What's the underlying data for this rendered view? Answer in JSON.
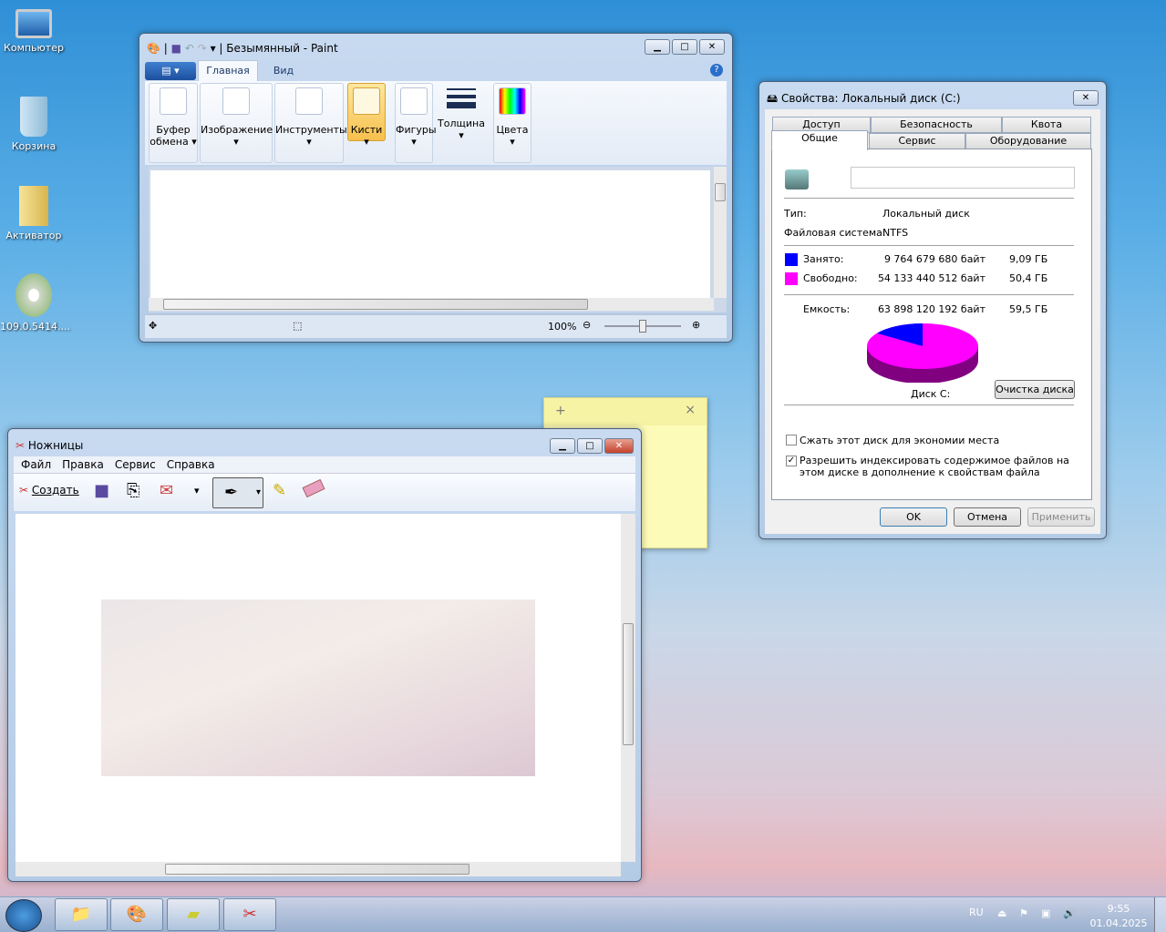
{
  "desktop": {
    "icons": [
      {
        "label": "Компьютер"
      },
      {
        "label": "Корзина"
      },
      {
        "label": "Активатор"
      },
      {
        "label": "109.0.5414...."
      }
    ]
  },
  "paint": {
    "title": "Безымянный - Paint",
    "tabs": [
      {
        "label": "Главная"
      },
      {
        "label": "Вид"
      }
    ],
    "groups": [
      {
        "label": "Буфер обмена"
      },
      {
        "label": "Изображение"
      },
      {
        "label": "Инструменты"
      },
      {
        "label": "Кисти"
      },
      {
        "label": "Фигуры"
      },
      {
        "label": "Толщина"
      },
      {
        "label": "Цвета"
      }
    ],
    "zoom": "100%"
  },
  "props": {
    "title": "Свойства: Локальный диск (C:)",
    "tabs_back": [
      {
        "label": "Доступ"
      },
      {
        "label": "Безопасность"
      },
      {
        "label": "Квота"
      }
    ],
    "tabs_front": [
      {
        "label": "Общие"
      },
      {
        "label": "Сервис"
      },
      {
        "label": "Оборудование"
      }
    ],
    "name_value": "",
    "type_label": "Тип:",
    "type_value": "Локальный диск",
    "fs_label": "Файловая система:",
    "fs_value": "NTFS",
    "used_label": "Занято:",
    "used_bytes": "9 764 679 680 байт",
    "used_gb": "9,09 ГБ",
    "free_label": "Свободно:",
    "free_bytes": "54 133 440 512 байт",
    "free_gb": "50,4 ГБ",
    "cap_label": "Емкость:",
    "cap_bytes": "63 898 120 192 байт",
    "cap_gb": "59,5 ГБ",
    "used_fraction": 0.153,
    "used_color": "#0000ff",
    "free_color": "#ff00ff",
    "disk_label": "Диск C:",
    "cleanup_button": "Очистка диска",
    "compress_label": "Сжать этот диск для экономии места",
    "compress_checked": false,
    "index_label": "Разрешить индексировать содержимое файлов на этом диске в дополнение к свойствам файла",
    "index_checked": true,
    "ok": "OK",
    "cancel": "Отмена",
    "apply": "Применить"
  },
  "sticky": {
    "add": "+",
    "close": "×"
  },
  "snip": {
    "title": "Ножницы",
    "menu": [
      {
        "label": "Файл"
      },
      {
        "label": "Правка"
      },
      {
        "label": "Сервис"
      },
      {
        "label": "Справка"
      }
    ],
    "new_button": "Создать"
  },
  "taskbar": {
    "lang": "RU",
    "time": "9:55",
    "date": "01.04.2025"
  }
}
